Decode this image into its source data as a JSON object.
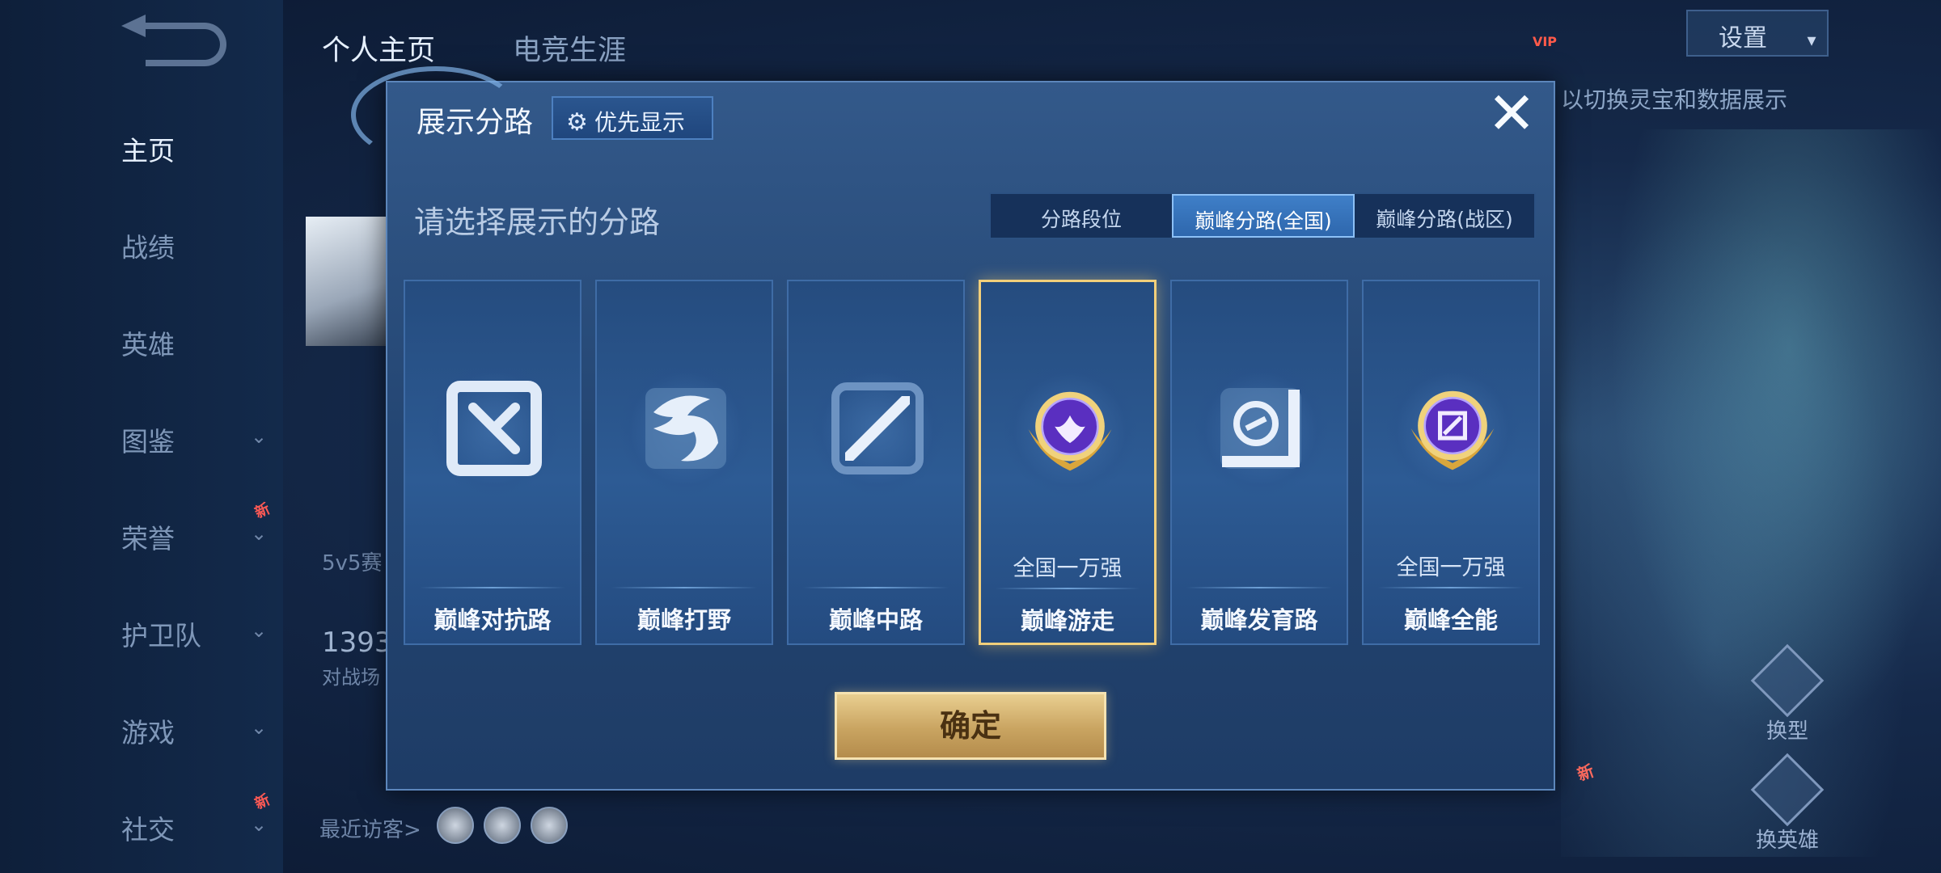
{
  "top_tabs": [
    "个人主页",
    "电竞生涯"
  ],
  "sidebar": {
    "items": [
      {
        "label": "主页",
        "active": true,
        "chevron": false,
        "badge": ""
      },
      {
        "label": "战绩",
        "active": false,
        "chevron": false,
        "badge": ""
      },
      {
        "label": "英雄",
        "active": false,
        "chevron": false,
        "badge": ""
      },
      {
        "label": "图鉴",
        "active": false,
        "chevron": true,
        "badge": ""
      },
      {
        "label": "荣誉",
        "active": false,
        "chevron": true,
        "badge": "新"
      },
      {
        "label": "护卫队",
        "active": false,
        "chevron": true,
        "badge": ""
      },
      {
        "label": "游戏",
        "active": false,
        "chevron": true,
        "badge": ""
      },
      {
        "label": "社交",
        "active": false,
        "chevron": true,
        "badge": "新"
      }
    ]
  },
  "background": {
    "mode_text": "5v5赛",
    "score_number": "1393",
    "score_caption": "对战场",
    "recent_visitors": "最近访客>",
    "vip_label": "VIP",
    "settings_label": "设置",
    "hint_text": "以切换灵宝和数据展示",
    "side_buttons": [
      "换型",
      "换英雄"
    ],
    "new_badge": "新"
  },
  "modal": {
    "title": "展示分路",
    "priority_button": "优先显示",
    "close_symbol": "✕",
    "subtitle": "请选择展示的分路",
    "segments": [
      {
        "label": "分路段位",
        "active": false
      },
      {
        "label": "巅峰分路(全国)",
        "active": true
      },
      {
        "label": "巅峰分路(战区)",
        "active": false
      }
    ],
    "cards": [
      {
        "label": "巅峰对抗路",
        "rank": "",
        "icon": "clash-lane-icon",
        "selected": false
      },
      {
        "label": "巅峰打野",
        "rank": "",
        "icon": "jungle-dragon-icon",
        "selected": false
      },
      {
        "label": "巅峰中路",
        "rank": "",
        "icon": "mid-lane-icon",
        "selected": false
      },
      {
        "label": "巅峰游走",
        "rank": "全国一万强",
        "icon": "roam-gold-badge-icon",
        "selected": true
      },
      {
        "label": "巅峰发育路",
        "rank": "",
        "icon": "farm-lane-icon",
        "selected": false
      },
      {
        "label": "巅峰全能",
        "rank": "全国一万强",
        "icon": "allround-gold-badge-icon",
        "selected": false
      }
    ],
    "confirm_button": "确定"
  },
  "colors": {
    "modal_bg": "#244673",
    "gold_accent": "#f2cf7a",
    "segment_active": "#3f7fc8"
  }
}
